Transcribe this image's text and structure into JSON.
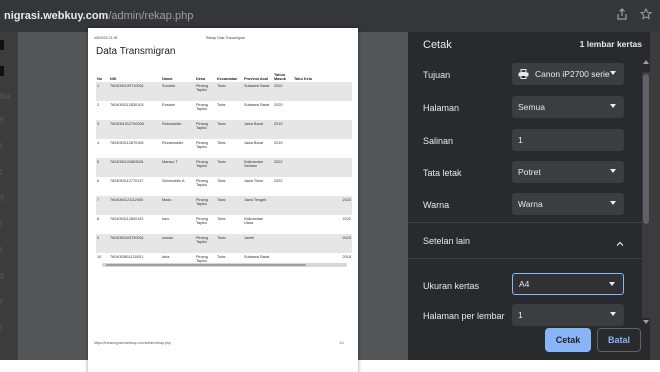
{
  "browser": {
    "host": "nigrasi.webkuy.com",
    "path": "/admin/rekap.php"
  },
  "preview": {
    "header_date": "4/6/2023 21.39",
    "header_title": "Rekap Data Transmigran",
    "doc_title": "Data Transmigran",
    "columns": [
      "No",
      "NIK",
      "Nama",
      "Desa",
      "Kecamatan",
      "Provinsi Asal",
      "Tahun Masuk",
      "Tahu Kelu"
    ],
    "rows": [
      [
        "1",
        "7604050109710001",
        "Sunarto",
        "Pinang Tapiko",
        "Tutar",
        "Sulawesi Barat",
        "2020",
        ""
      ],
      [
        "2",
        "7604053112830103",
        "Rustam",
        "Pinang Tapiko",
        "Tutar",
        "Sulawesi Barat",
        "2020",
        ""
      ],
      [
        "3",
        "7604051312700008",
        "Rahmaddin",
        "Pinang Tapiko",
        "Tutar",
        "Jawa Barat",
        "2019",
        ""
      ],
      [
        "4",
        "7604053112870106",
        "Rezamuddin",
        "Pinang Tapiko",
        "Tutar",
        "Jawa Barat",
        "2019",
        ""
      ],
      [
        "5",
        "7604050100883001",
        "Mansur T",
        "Pinang Tapiko",
        "Tutar",
        "Kalimantan Selatan",
        "2022",
        ""
      ],
      [
        "6",
        "7604053112770137",
        "Sahmuddin A",
        "Pinang Tapiko",
        "Tutar",
        "Jawa Timur",
        "2022",
        ""
      ],
      [
        "7",
        "7604050121112000",
        "Madu",
        "Pinang Tapiko",
        "Tutar",
        "Jawa Tengah",
        "",
        "2023"
      ],
      [
        "8",
        "7604053112800192",
        "karo",
        "Pinang Tapiko",
        "Tutar",
        "Kalimantan Utara",
        "",
        "2022"
      ],
      [
        "9",
        "7604050403790001",
        "usman",
        "Pinang Tapiko",
        "Tutar",
        "Jambi",
        "",
        "2023"
      ],
      [
        "10",
        "7604053811120001",
        "laha",
        "Pinang Tapiko",
        "Tutar",
        "Sulawesi Barat",
        "",
        "2018"
      ]
    ],
    "footer_url": "https://transmigrasi.webkuy.com/admin/rekap.php",
    "footer_page": "1/1"
  },
  "print": {
    "title": "Cetak",
    "sheets": "1 lembar kertas",
    "destination_label": "Tujuan",
    "destination_value": "Canon iP2700 serie",
    "pages_label": "Halaman",
    "pages_value": "Semua",
    "copies_label": "Salinan",
    "copies_value": "1",
    "layout_label": "Tata letak",
    "layout_value": "Potret",
    "color_label": "Warna",
    "color_value": "Warna",
    "more_settings": "Setelan lain",
    "paper_size_label": "Ukuran kertas",
    "paper_size_value": "A4",
    "pages_per_sheet_label": "Halaman per lembar",
    "pages_per_sheet_value": "1",
    "print_button": "Cetak",
    "cancel_button": "Batal"
  },
  "background": {
    "edge_letters": [
      "Na",
      "fi",
      "f",
      "f",
      "fi",
      "f",
      "f",
      "fi",
      "f",
      "f"
    ]
  },
  "colors": {
    "panel_bg": "#292a2d",
    "field_bg": "#3c3d40",
    "accent": "#8ab4f8",
    "preview_bg": "#525659"
  }
}
